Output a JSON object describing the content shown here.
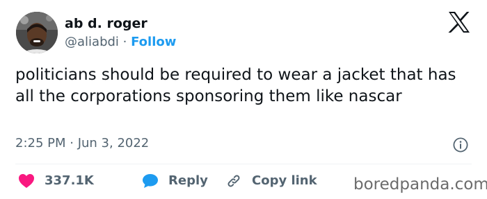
{
  "author": {
    "name": "ab d. roger",
    "handle": "@aliabdi",
    "separator": " · ",
    "follow_label": "Follow"
  },
  "platform_icon": "x-logo-icon",
  "tweet": {
    "text": "politicians should be required to wear a jacket that has all the corporations sponsoring them like nascar",
    "time": "2:25 PM",
    "date_separator": " · ",
    "date": "Jun 3, 2022"
  },
  "actions": {
    "likes_count": "337.1K",
    "reply_label": "Reply",
    "copy_link_label": "Copy link"
  },
  "watermark": "boredpanda.com",
  "colors": {
    "text": "#0f1419",
    "secondary": "#536471",
    "accent": "#1d9bf0",
    "like": "#f91880",
    "reply": "#1d9bf0"
  },
  "icons": [
    "heart-icon",
    "speech-bubble-icon",
    "link-icon",
    "info-icon",
    "x-logo-icon"
  ]
}
